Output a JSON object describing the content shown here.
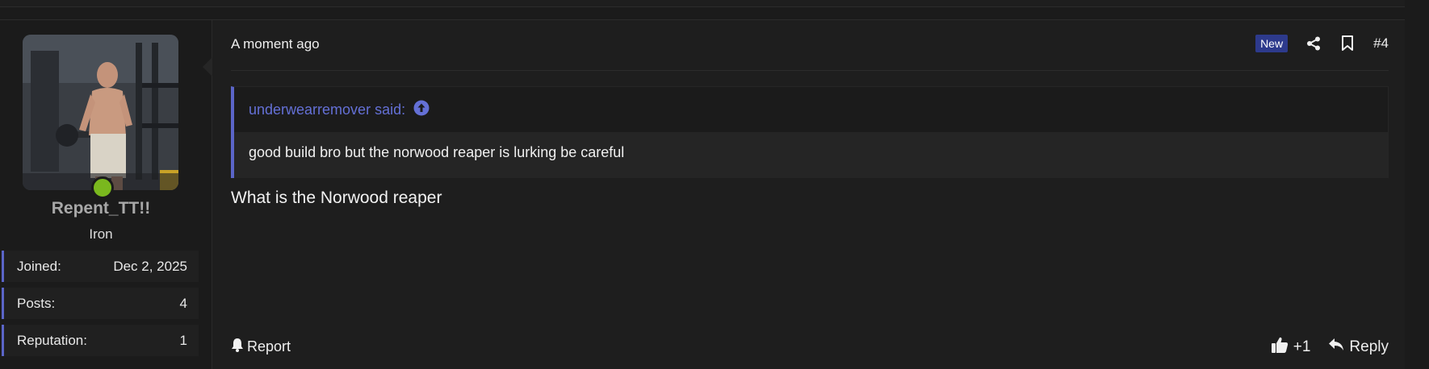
{
  "user": {
    "username": "Repent_TT!!",
    "title": "Iron",
    "online_color": "#7ab81e",
    "stats": [
      {
        "label": "Joined:",
        "value": "Dec 2, 2025"
      },
      {
        "label": "Posts:",
        "value": "4"
      },
      {
        "label": "Reputation:",
        "value": "1"
      }
    ]
  },
  "post": {
    "timestamp": "A moment ago",
    "badge": "New",
    "number": "#4",
    "quote": {
      "author": "underwearremover said:",
      "text": "good build bro but the norwood reaper is lurking be careful"
    },
    "message": "What is the Norwood reaper",
    "footer": {
      "report": "Report",
      "like": "+1",
      "reply": "Reply"
    }
  },
  "colors": {
    "accent": "#5b65c8",
    "quote_link": "#6470d6",
    "badge_bg": "#2d3a8c",
    "background": "#1e1e1e"
  },
  "icons": [
    "share-icon",
    "bookmark-icon",
    "arrow-up-circle-icon",
    "bell-icon",
    "thumbs-up-icon",
    "reply-icon"
  ]
}
